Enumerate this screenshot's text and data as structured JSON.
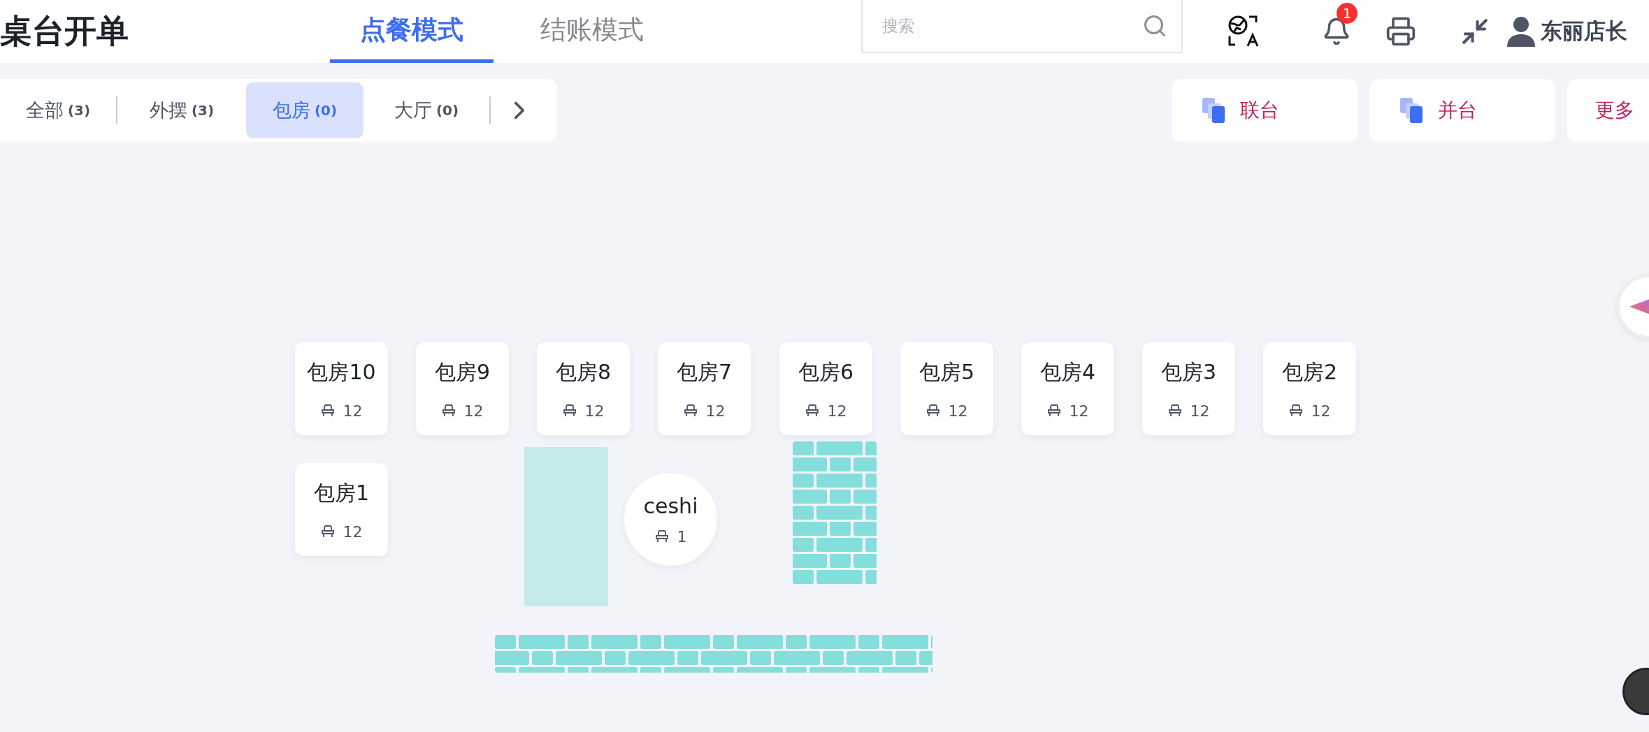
{
  "title": "桌台开单",
  "modes": [
    {
      "label": "点餐模式",
      "selected": true
    },
    {
      "label": "结账模式",
      "selected": false
    }
  ],
  "search": {
    "placeholder": "搜索"
  },
  "notifications": {
    "badge": "1"
  },
  "user": {
    "name": "东丽店长"
  },
  "areas": [
    {
      "label": "全部",
      "count": "(3)",
      "selected": false
    },
    {
      "label": "外摆",
      "count": "(3)",
      "selected": false
    },
    {
      "label": "包房",
      "count": "(0)",
      "selected": true
    },
    {
      "label": "大厅",
      "count": "(0)",
      "selected": false
    }
  ],
  "actions": [
    {
      "label": "联台",
      "kind": "icon"
    },
    {
      "label": "并台",
      "kind": "icon"
    },
    {
      "label": "更多",
      "kind": "text"
    }
  ],
  "tables": [
    {
      "name": "包房10",
      "seats": "12",
      "kind": "square"
    },
    {
      "name": "包房9",
      "seats": "12",
      "kind": "square"
    },
    {
      "name": "包房8",
      "seats": "12",
      "kind": "square"
    },
    {
      "name": "包房7",
      "seats": "12",
      "kind": "square"
    },
    {
      "name": "包房6",
      "seats": "12",
      "kind": "square"
    },
    {
      "name": "包房5",
      "seats": "12",
      "kind": "square"
    },
    {
      "name": "包房4",
      "seats": "12",
      "kind": "square"
    },
    {
      "name": "包房3",
      "seats": "12",
      "kind": "square"
    },
    {
      "name": "包房2",
      "seats": "12",
      "kind": "square"
    },
    {
      "name": "包房1",
      "seats": "12",
      "kind": "square"
    },
    {
      "name": "ceshi",
      "seats": "1",
      "kind": "round"
    }
  ],
  "floor_items": [
    {
      "kind": "partition"
    },
    {
      "kind": "brick_wall"
    },
    {
      "kind": "brick_wall"
    }
  ]
}
